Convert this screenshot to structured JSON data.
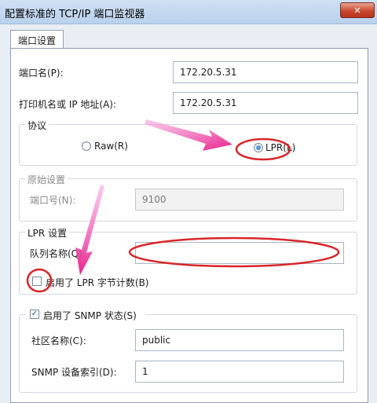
{
  "window": {
    "title": "配置标准的 TCP/IP 端口监视器",
    "close_glyph": "✕"
  },
  "tabs": [
    {
      "label": "端口设置",
      "selected": true
    }
  ],
  "port_name": {
    "label": "端口名(P):",
    "value": "172.20.5.31"
  },
  "printer_address": {
    "label": "打印机名或 IP 地址(A):",
    "value": "172.20.5.31"
  },
  "protocol": {
    "title": "协议",
    "raw_label": "Raw(R)",
    "lpr_label": "LPR(L)",
    "selected": "LPR"
  },
  "raw_settings": {
    "title": "原始设置",
    "port_number_label": "端口号(N):",
    "port_number_value": "9100",
    "enabled": false
  },
  "lpr_settings": {
    "title": "LPR 设置",
    "queue_name_label": "队列名称(Q):",
    "queue_name_value": "",
    "byte_count_label": "启用了 LPR 字节计数(B)",
    "byte_count_checked": false
  },
  "snmp": {
    "label": "启用了 SNMP 状态(S)",
    "checked": true,
    "checkmark_glyph": "✓",
    "community_label": "社区名称(C):",
    "community_value": "public",
    "device_index_label": "SNMP 设备索引(D):",
    "device_index_value": "1"
  },
  "annotations": {
    "color": "#e8218d",
    "circle_color": "#d8262a"
  }
}
